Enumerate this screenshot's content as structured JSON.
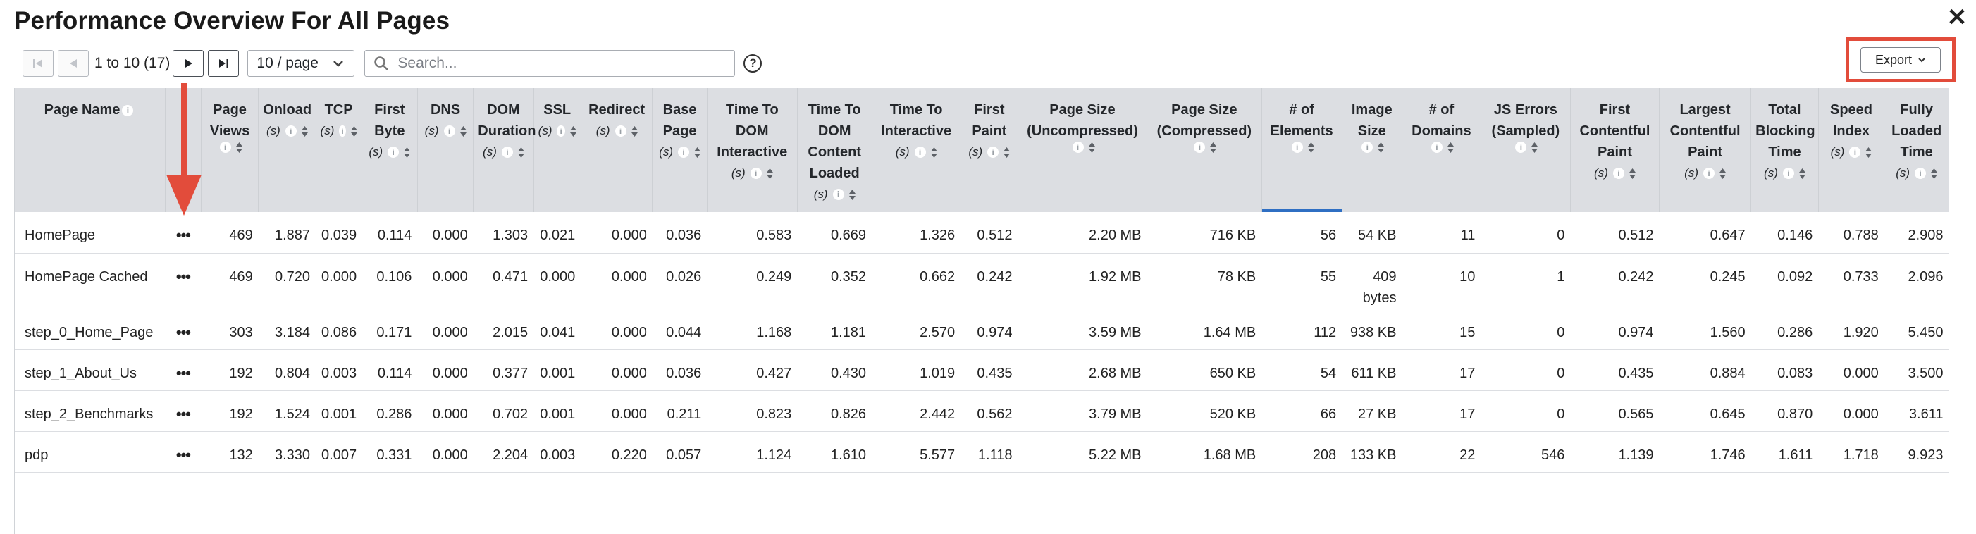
{
  "title": "Performance Overview For All Pages",
  "pagination": {
    "range_text": "1 to 10 (17)",
    "page_size": "10 / page"
  },
  "search": {
    "placeholder": "Search..."
  },
  "help_label": "?",
  "export_label": "Export",
  "icons": {
    "close": "close-icon",
    "first": "first-page-icon",
    "prev": "prev-page-icon",
    "next": "next-page-icon",
    "last": "last-page-icon",
    "search": "search-icon",
    "help": "help-icon",
    "info": "info-icon",
    "sort": "sort-icon",
    "menu": "more-options-icon",
    "chevron": "chevron-down-icon"
  },
  "accent_colors": {
    "annotation": "#e24c3b",
    "sort_indicator": "#2f6fc3",
    "header_bg": "#dcdee2"
  },
  "columns": [
    {
      "label": "Page Name",
      "unit": ""
    },
    {
      "label": "",
      "unit": ""
    },
    {
      "label": "Page Views",
      "unit": ""
    },
    {
      "label": "Onload",
      "unit": "(s)"
    },
    {
      "label": "TCP",
      "unit": "(s)"
    },
    {
      "label": "First Byte",
      "unit": "(s)"
    },
    {
      "label": "DNS",
      "unit": "(s)"
    },
    {
      "label": "DOM Duration",
      "unit": "(s)"
    },
    {
      "label": "SSL",
      "unit": "(s)"
    },
    {
      "label": "Redirect",
      "unit": "(s)"
    },
    {
      "label": "Base Page",
      "unit": "(s)"
    },
    {
      "label": "Time To DOM Interactive",
      "unit": "(s)"
    },
    {
      "label": "Time To DOM Content Loaded",
      "unit": "(s)"
    },
    {
      "label": "Time To Interactive",
      "unit": "(s)"
    },
    {
      "label": "First Paint",
      "unit": "(s)"
    },
    {
      "label": "Page Size (Uncompressed)",
      "unit": ""
    },
    {
      "label": "Page Size (Compressed)",
      "unit": ""
    },
    {
      "label": "# of Elements",
      "unit": ""
    },
    {
      "label": "Image Size",
      "unit": ""
    },
    {
      "label": "# of Domains",
      "unit": ""
    },
    {
      "label": "JS Errors (Sampled)",
      "unit": ""
    },
    {
      "label": "First Contentful Paint",
      "unit": "(s)"
    },
    {
      "label": "Largest Contentful Paint",
      "unit": "(s)"
    },
    {
      "label": "Total Blocking Time",
      "unit": "(s)"
    },
    {
      "label": "Speed Index",
      "unit": "(s)"
    },
    {
      "label": "Fully Loaded Time",
      "unit": "(s)"
    }
  ],
  "rows": [
    {
      "name": "HomePage",
      "menu": "•••",
      "cells": [
        "469",
        "1.887",
        "0.039",
        "0.114",
        "0.000",
        "1.303",
        "0.021",
        "0.000",
        "0.036",
        "0.583",
        "0.669",
        "1.326",
        "0.512",
        "2.20 MB",
        "716 KB",
        "56",
        "54 KB",
        "11",
        "0",
        "0.512",
        "0.647",
        "0.146",
        "0.788",
        "2.908"
      ]
    },
    {
      "name": "HomePage Cached",
      "menu": "•••",
      "cells": [
        "469",
        "0.720",
        "0.000",
        "0.106",
        "0.000",
        "0.471",
        "0.000",
        "0.000",
        "0.026",
        "0.249",
        "0.352",
        "0.662",
        "0.242",
        "1.92 MB",
        "78 KB",
        "55",
        "409 bytes",
        "10",
        "1",
        "0.242",
        "0.245",
        "0.092",
        "0.733",
        "2.096"
      ]
    },
    {
      "name": "step_0_Home_Page",
      "menu": "•••",
      "cells": [
        "303",
        "3.184",
        "0.086",
        "0.171",
        "0.000",
        "2.015",
        "0.041",
        "0.000",
        "0.044",
        "1.168",
        "1.181",
        "2.570",
        "0.974",
        "3.59 MB",
        "1.64 MB",
        "112",
        "938 KB",
        "15",
        "0",
        "0.974",
        "1.560",
        "0.286",
        "1.920",
        "5.450"
      ]
    },
    {
      "name": "step_1_About_Us",
      "menu": "•••",
      "cells": [
        "192",
        "0.804",
        "0.003",
        "0.114",
        "0.000",
        "0.377",
        "0.001",
        "0.000",
        "0.036",
        "0.427",
        "0.430",
        "1.019",
        "0.435",
        "2.68 MB",
        "650 KB",
        "54",
        "611 KB",
        "17",
        "0",
        "0.435",
        "0.884",
        "0.083",
        "0.000",
        "3.500"
      ]
    },
    {
      "name": "step_2_Benchmarks",
      "menu": "•••",
      "cells": [
        "192",
        "1.524",
        "0.001",
        "0.286",
        "0.000",
        "0.702",
        "0.001",
        "0.000",
        "0.211",
        "0.823",
        "0.826",
        "2.442",
        "0.562",
        "3.79 MB",
        "520 KB",
        "66",
        "27 KB",
        "17",
        "0",
        "0.565",
        "0.645",
        "0.870",
        "0.000",
        "3.611"
      ]
    },
    {
      "name": "pdp",
      "menu": "•••",
      "cells": [
        "132",
        "3.330",
        "0.007",
        "0.331",
        "0.000",
        "2.204",
        "0.003",
        "0.220",
        "0.057",
        "1.124",
        "1.610",
        "5.577",
        "1.118",
        "5.22 MB",
        "1.68 MB",
        "208",
        "133 KB",
        "22",
        "546",
        "1.139",
        "1.746",
        "1.611",
        "1.718",
        "9.923"
      ]
    }
  ]
}
